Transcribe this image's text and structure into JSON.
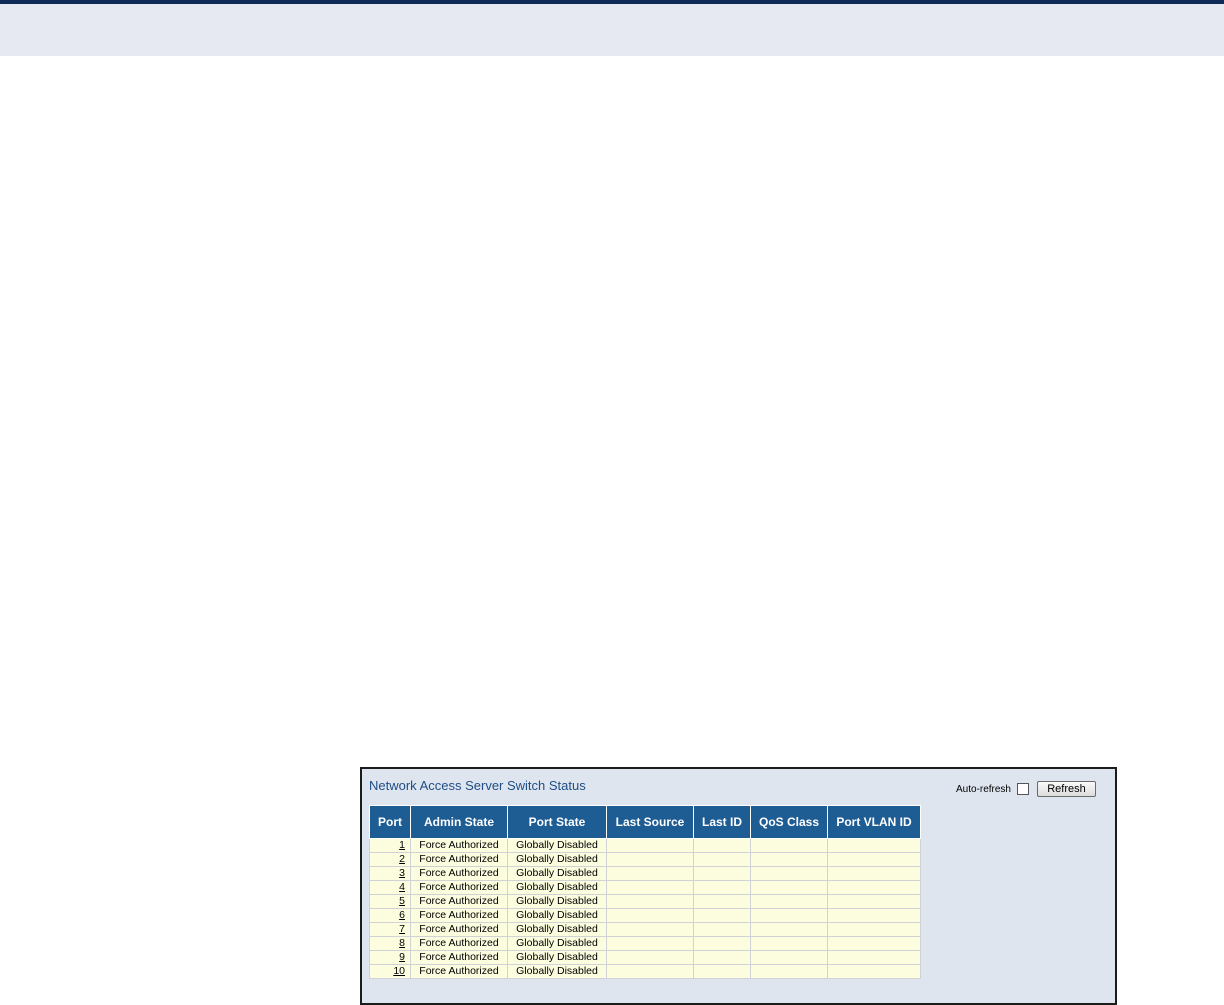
{
  "panel": {
    "title": "Network Access Server Switch Status"
  },
  "controls": {
    "auto_refresh_label": "Auto-refresh",
    "auto_refresh_checked": false,
    "refresh_label": "Refresh"
  },
  "table": {
    "headers": [
      "Port",
      "Admin State",
      "Port State",
      "Last Source",
      "Last ID",
      "QoS Class",
      "Port VLAN ID"
    ],
    "rows": [
      {
        "port": "1",
        "admin_state": "Force Authorized",
        "port_state": "Globally Disabled",
        "last_source": "",
        "last_id": "",
        "qos_class": "",
        "port_vlan_id": ""
      },
      {
        "port": "2",
        "admin_state": "Force Authorized",
        "port_state": "Globally Disabled",
        "last_source": "",
        "last_id": "",
        "qos_class": "",
        "port_vlan_id": ""
      },
      {
        "port": "3",
        "admin_state": "Force Authorized",
        "port_state": "Globally Disabled",
        "last_source": "",
        "last_id": "",
        "qos_class": "",
        "port_vlan_id": ""
      },
      {
        "port": "4",
        "admin_state": "Force Authorized",
        "port_state": "Globally Disabled",
        "last_source": "",
        "last_id": "",
        "qos_class": "",
        "port_vlan_id": ""
      },
      {
        "port": "5",
        "admin_state": "Force Authorized",
        "port_state": "Globally Disabled",
        "last_source": "",
        "last_id": "",
        "qos_class": "",
        "port_vlan_id": ""
      },
      {
        "port": "6",
        "admin_state": "Force Authorized",
        "port_state": "Globally Disabled",
        "last_source": "",
        "last_id": "",
        "qos_class": "",
        "port_vlan_id": ""
      },
      {
        "port": "7",
        "admin_state": "Force Authorized",
        "port_state": "Globally Disabled",
        "last_source": "",
        "last_id": "",
        "qos_class": "",
        "port_vlan_id": ""
      },
      {
        "port": "8",
        "admin_state": "Force Authorized",
        "port_state": "Globally Disabled",
        "last_source": "",
        "last_id": "",
        "qos_class": "",
        "port_vlan_id": ""
      },
      {
        "port": "9",
        "admin_state": "Force Authorized",
        "port_state": "Globally Disabled",
        "last_source": "",
        "last_id": "",
        "qos_class": "",
        "port_vlan_id": ""
      },
      {
        "port": "10",
        "admin_state": "Force Authorized",
        "port_state": "Globally Disabled",
        "last_source": "",
        "last_id": "",
        "qos_class": "",
        "port_vlan_id": ""
      }
    ]
  },
  "colors": {
    "header_band": "#e6e9f2",
    "top_rule": "#0f2a57",
    "table_header": "#1e5c94",
    "row_background": "#fcfcdf",
    "panel_background": "#dfe5ef",
    "title_text": "#1e4e86"
  }
}
